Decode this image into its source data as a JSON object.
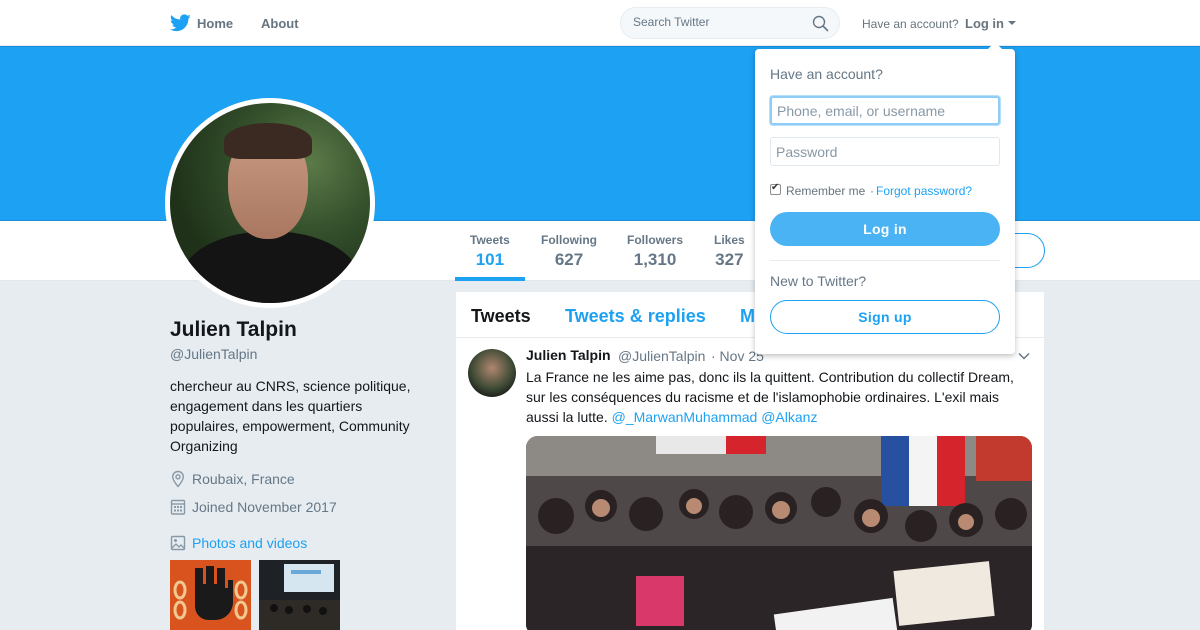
{
  "nav": {
    "home_label": "Home",
    "about_label": "About",
    "search_placeholder": "Search Twitter",
    "have_account_text": "Have an account?",
    "login_label": "Log in"
  },
  "profile": {
    "name": "Julien Talpin",
    "handle": "@JulienTalpin",
    "bio": "chercheur au CNRS, science politique, engagement dans les quartiers populaires, empowerment, Community Organizing",
    "location": "Roubaix, France",
    "joined": "Joined November 2017",
    "photos_label": "Photos and videos"
  },
  "stats": [
    {
      "label": "Tweets",
      "value": "101"
    },
    {
      "label": "Following",
      "value": "627"
    },
    {
      "label": "Followers",
      "value": "1,310"
    },
    {
      "label": "Likes",
      "value": "327"
    }
  ],
  "timeline": {
    "tabs": [
      "Tweets",
      "Tweets & replies",
      "M"
    ],
    "tweet": {
      "author_name": "Julien Talpin",
      "author_handle": "@JulienTalpin",
      "date": "· Nov 25",
      "text": "La France ne les aime pas, donc ils la quittent. Contribution du collectif Dream, sur les conséquences du racisme et de l'islamophobie ordinaires. L'exil mais aussi la lutte.",
      "mention1": "@_MarwanMuhammad",
      "mention2": "@Alkanz"
    }
  },
  "login_dropdown": {
    "title": "Have an account?",
    "username_placeholder": "Phone, email, or username",
    "password_placeholder": "Password",
    "remember_label": "Remember me",
    "separator": "·",
    "forgot_label": "Forgot password?",
    "login_button": "Log in",
    "new_text": "New to Twitter?",
    "signup_button": "Sign up"
  },
  "colors": {
    "brand": "#1da1f2",
    "background": "#e6ecf0"
  }
}
